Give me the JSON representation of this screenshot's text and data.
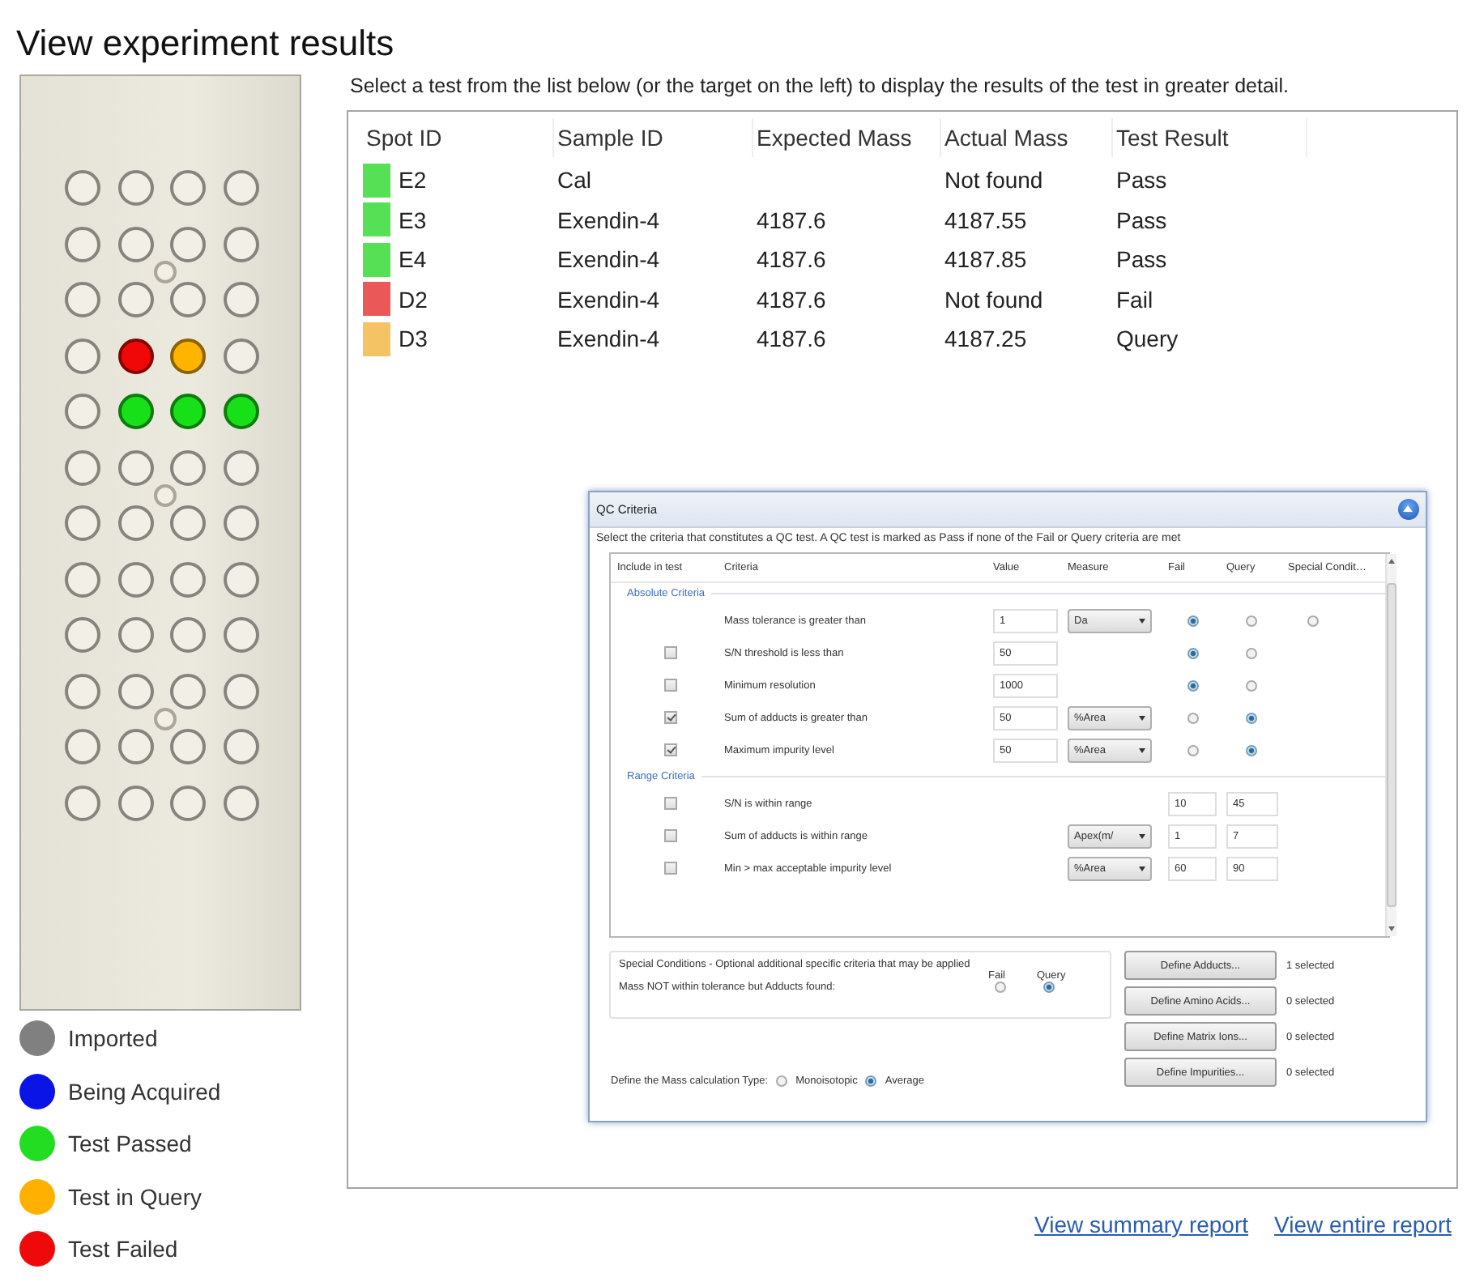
{
  "title": "View experiment results",
  "plate": {
    "rows": [
      [
        {
          "color": "#f2f0e6"
        },
        {
          "color": "#f2f0e6"
        },
        {
          "color": "#f2f0e6"
        },
        {
          "color": "#f2f0e6"
        }
      ],
      [
        {
          "color": "#f2f0e6"
        },
        {
          "color": "#f2f0e6"
        },
        {
          "color": "#f2f0e6"
        },
        {
          "color": "#f2f0e6"
        }
      ],
      [
        {
          "color": "#f2f0e6"
        },
        {
          "color": "#f2f0e6"
        },
        {
          "color": "#f2f0e6"
        },
        {
          "color": "#f2f0e6"
        }
      ],
      [
        {
          "color": "#f2f0e6"
        },
        {
          "color": "#f00808"
        },
        {
          "color": "#ffb400"
        },
        {
          "color": "#f2f0e6"
        }
      ],
      [
        {
          "color": "#f2f0e6"
        },
        {
          "color": "#18e018"
        },
        {
          "color": "#18e018"
        },
        {
          "color": "#18e018"
        }
      ],
      [
        {
          "color": "#f2f0e6"
        },
        {
          "color": "#f2f0e6"
        },
        {
          "color": "#f2f0e6"
        },
        {
          "color": "#f2f0e6"
        }
      ],
      [
        {
          "color": "#f2f0e6"
        },
        {
          "color": "#f2f0e6"
        },
        {
          "color": "#f2f0e6"
        },
        {
          "color": "#f2f0e6"
        }
      ],
      [
        {
          "color": "#f2f0e6"
        },
        {
          "color": "#f2f0e6"
        },
        {
          "color": "#f2f0e6"
        },
        {
          "color": "#f2f0e6"
        }
      ],
      [
        {
          "color": "#f2f0e6"
        },
        {
          "color": "#f2f0e6"
        },
        {
          "color": "#f2f0e6"
        },
        {
          "color": "#f2f0e6"
        }
      ],
      [
        {
          "color": "#f2f0e6"
        },
        {
          "color": "#f2f0e6"
        },
        {
          "color": "#f2f0e6"
        },
        {
          "color": "#f2f0e6"
        }
      ],
      [
        {
          "color": "#f2f0e6"
        },
        {
          "color": "#f2f0e6"
        },
        {
          "color": "#f2f0e6"
        },
        {
          "color": "#f2f0e6"
        }
      ],
      [
        {
          "color": "#f2f0e6"
        },
        {
          "color": "#f2f0e6"
        },
        {
          "color": "#f2f0e6"
        },
        {
          "color": "#f2f0e6"
        }
      ]
    ]
  },
  "legend": [
    {
      "label": "Imported",
      "color": "#808080"
    },
    {
      "label": "Being Acquired",
      "color": "#0a14e6"
    },
    {
      "label": "Test Passed",
      "color": "#22dd22"
    },
    {
      "label": "Test in Query",
      "color": "#ffb000"
    },
    {
      "label": "Test Failed",
      "color": "#ee0a0a"
    }
  ],
  "instructions": "Select a test from the list below (or the target on the left) to display the results of the test in greater detail.",
  "results": {
    "columns": [
      "Spot ID",
      "Sample ID",
      "Expected Mass",
      "Actual Mass",
      "Test Result"
    ],
    "rows": [
      {
        "spot": "E2",
        "color": "#55e055",
        "sample": "Cal",
        "actual": "Not found",
        "result": "Pass"
      },
      {
        "spot": "E3",
        "color": "#55e055",
        "sample": "Exendin-4",
        "expected": "4187.6",
        "actual": "4187.55",
        "result": "Pass"
      },
      {
        "spot": "E4",
        "color": "#55e055",
        "sample": "Exendin-4",
        "expected": "4187.6",
        "actual": "4187.85",
        "result": "Pass"
      },
      {
        "spot": "D2",
        "color": "#ea5858",
        "sample": "Exendin-4",
        "expected": "4187.6",
        "actual": "Not found",
        "result": "Fail"
      },
      {
        "spot": "D3",
        "color": "#f4c464",
        "sample": "Exendin-4",
        "expected": "4187.6",
        "actual": "4187.25",
        "result": "Query"
      }
    ]
  },
  "links": [
    "View summary report",
    "View entire report"
  ],
  "qc_dialog": {
    "title": "QC Criteria",
    "description": "Select the criteria that constitutes a QC test. A QC test is marked as Pass if none of the Fail or Query criteria are met",
    "columns": [
      "Include in test",
      "Criteria",
      "Value",
      "Measure",
      "Fail",
      "Query",
      "Special Condit…"
    ],
    "sections": [
      {
        "title": "Absolute Criteria",
        "rows": [
          {
            "kind": "absolute",
            "label": "Mass tolerance is greater than",
            "value": "1",
            "measure": "Da",
            "fail": true,
            "query": false,
            "special": false
          },
          {
            "kind": "absolute",
            "checked": false,
            "label": "S/N threshold is less than",
            "value": "50",
            "fail": true,
            "query": false
          },
          {
            "kind": "absolute",
            "checked": false,
            "label": "Minimum resolution",
            "value": "1000",
            "fail": true,
            "query": false
          },
          {
            "kind": "absolute",
            "checked": true,
            "label": "Sum of adducts is greater than",
            "value": "50",
            "measure": "%Area",
            "fail": false,
            "query": true
          },
          {
            "kind": "absolute",
            "checked": true,
            "label": "Maximum impurity level",
            "value": "50",
            "measure": "%Area",
            "fail": false,
            "query": true
          }
        ]
      },
      {
        "title": "Range Criteria",
        "rows": [
          {
            "kind": "range",
            "checked": false,
            "label": "S/N is within range",
            "low": "10",
            "high": "45"
          },
          {
            "kind": "range",
            "checked": false,
            "label": "Sum of adducts is within range",
            "measure": "Apex(m/",
            "low": "1",
            "high": "7"
          },
          {
            "kind": "range",
            "checked": false,
            "label": "Min > max acceptable impurity level",
            "measure": "%Area",
            "low": "60",
            "high": "90"
          }
        ]
      }
    ],
    "special_conditions": {
      "title": "Special Conditions - Optional additional specific criteria that may be applied",
      "fail_label": "Fail",
      "query_label": "Query",
      "condition": {
        "label": "Mass NOT within tolerance but Adducts found:",
        "fail": false,
        "query": true
      }
    },
    "define_buttons": [
      {
        "label": "Define Adducts...",
        "count": "1 selected"
      },
      {
        "label": "Define Amino Acids...",
        "count": "0 selected"
      },
      {
        "label": "Define Matrix Ions...",
        "count": "0 selected"
      },
      {
        "label": "Define Impurities...",
        "count": "0 selected"
      }
    ],
    "mass_type": {
      "label": "Define the Mass calculation Type:",
      "options": [
        {
          "label": "Monoisotopic",
          "selected": false
        },
        {
          "label": "Average",
          "selected": true
        }
      ]
    }
  }
}
